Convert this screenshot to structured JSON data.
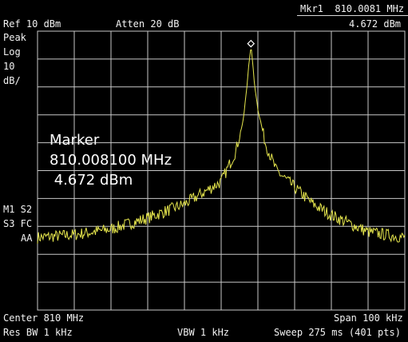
{
  "header": {
    "marker_readout_freq": "Mkr1  810.0081 MHz",
    "ref_level": "Ref 10 dBm",
    "attenuation": "Atten 20 dB",
    "marker_readout_amp": "4.672 dBm"
  },
  "left_labels": {
    "detector": "Peak",
    "scale_type": "Log",
    "scale_value": "10",
    "scale_unit": "dB/",
    "trace_mode_1": "M1 S2",
    "trace_mode_2": "S3 FC",
    "trace_mode_3": "AA"
  },
  "marker_box": {
    "title": "Marker",
    "frequency": "810.008100 MHz",
    "amplitude": " 4.672 dBm"
  },
  "footer": {
    "center": "Center 810 MHz",
    "span": "Span 100 kHz",
    "rbw": "Res BW 1 kHz",
    "vbw": "VBW 1 kHz",
    "sweep": "Sweep 275 ms (401 pts)"
  },
  "colors": {
    "background": "#000000",
    "grid": "#c8c8c8",
    "trace": "#e6e64d",
    "text": "#ffffff"
  },
  "chart_data": {
    "type": "line",
    "title": "",
    "x_center_mhz": 810,
    "x_span_khz": 100,
    "xlim_mhz": [
      809.95,
      810.05
    ],
    "y_ref_dbm": 10,
    "y_scale_db_per_div": 10,
    "ylim_dbm": [
      -90,
      10
    ],
    "grid": true,
    "num_points": 401,
    "marker": {
      "name": "Mkr1",
      "x_mhz": 810.0081,
      "y_dbm": 4.672
    },
    "series": [
      {
        "x_mhz": [
          809.95,
          809.96,
          809.97,
          809.98,
          809.99,
          809.995,
          810.0,
          810.004,
          810.006,
          810.007,
          810.0075,
          810.008,
          810.0081,
          810.0085,
          810.009,
          810.01,
          810.012,
          810.015,
          810.02,
          810.025,
          810.03,
          810.04,
          810.05
        ],
        "y_dbm": [
          -64,
          -63,
          -61,
          -57,
          -52,
          -48,
          -44,
          -33,
          -22,
          -10,
          -2,
          3,
          4.672,
          0,
          -8,
          -18,
          -30,
          -40,
          -46,
          -52,
          -56,
          -62,
          -64
        ]
      }
    ]
  }
}
